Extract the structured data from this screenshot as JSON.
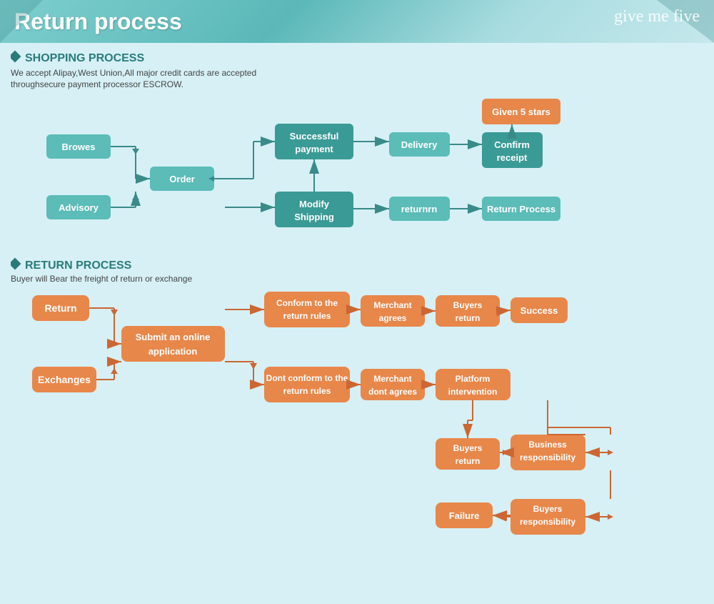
{
  "header": {
    "title": "Return process",
    "brand": "give me five"
  },
  "shopping_section": {
    "title": "SHOPPING PROCESS",
    "subtitle": "We accept Alipay,West Union,All major credit cards are accepted throughsecure payment processor ESCROW.",
    "nodes": {
      "browes": "Browes",
      "order": "Order",
      "advisory": "Advisory",
      "successful_payment": "Successful payment",
      "modify_shipping": "Modify Shipping",
      "delivery": "Delivery",
      "confirm_receipt": "Confirm receipt",
      "given_5_stars": "Given 5 stars",
      "returnrn": "returnrn",
      "return_process": "Return Process"
    }
  },
  "return_section": {
    "title": "RETURN PROCESS",
    "subtitle": "Buyer will Bear the freight of return or exchange",
    "nodes": {
      "return": "Return",
      "exchanges": "Exchanges",
      "submit_application": "Submit an online application",
      "conform_rules": "Conform to the return rules",
      "merchant_agrees": "Merchant agrees",
      "buyers_return": "Buyers return",
      "success": "Success",
      "dont_conform": "Dont conform to the return rules",
      "merchant_dont": "Merchant dont agrees",
      "platform_intervention": "Platform intervention",
      "buyers_return2": "Buyers return",
      "business_responsibility": "Business responsibility",
      "failure": "Failure",
      "buyers_responsibility": "Buyers responsibility"
    }
  }
}
